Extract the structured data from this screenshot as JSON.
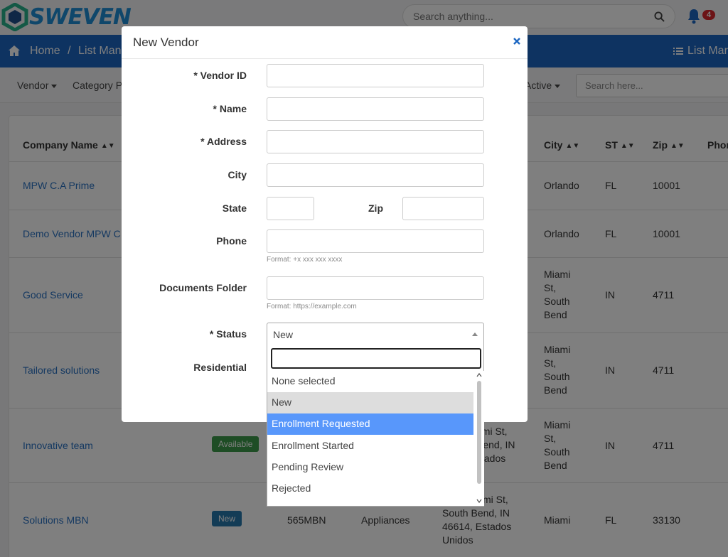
{
  "app": {
    "logo_text": "SWEVEN",
    "search_placeholder": "Search anything...",
    "notification_count": "4",
    "colors": {
      "brand_blue": "#1d67c2",
      "link": "#2b72c3",
      "badge_available": "#3d9a4a",
      "badge_new": "#2779ad",
      "select_active": "#5897fb"
    }
  },
  "navbar": {
    "home": "Home",
    "separator": "/",
    "list_manager": "List Mana",
    "right_label": "List Mar"
  },
  "filters": {
    "vendor": "Vendor",
    "category": "Category Pr",
    "active": "Active",
    "search_placeholder": "Search here..."
  },
  "table": {
    "headers": {
      "company": "Company Name",
      "city": "City",
      "st": "ST",
      "zip": "Zip",
      "phone": "Phon"
    },
    "rows": [
      {
        "company": "MPW C.A Prime",
        "city": "Orlando",
        "st": "FL",
        "zip": "10001"
      },
      {
        "company": "Demo Vendor MPW C.A",
        "city": "Orlando",
        "st": "FL",
        "zip": "10001"
      },
      {
        "company": "Good Service",
        "city": [
          "Miami",
          "St,",
          "South",
          "Bend"
        ],
        "st": "IN",
        "zip": "4711"
      },
      {
        "company": "Tailored solutions",
        "city": [
          "Miami",
          "St,",
          "South",
          "Bend"
        ],
        "st": "IN",
        "zip": "4711"
      },
      {
        "company": "Innovative team",
        "status": "Available",
        "address": [
          "ami St,",
          "Bend, IN",
          "stados"
        ],
        "city": [
          "Miami",
          "St,",
          "South",
          "Bend"
        ],
        "st": "IN",
        "zip": "4711"
      },
      {
        "company": "Solutions MBN",
        "status": "New",
        "vendor_id": "565MBN",
        "category": "Appliances",
        "address": [
          "mi St,",
          "South Bend, IN",
          "46614, Estados",
          "Unidos"
        ],
        "city": "Miami",
        "st": "FL",
        "zip": "33130"
      }
    ]
  },
  "modal": {
    "title": "New Vendor",
    "fields": {
      "vendor_id": "* Vendor ID",
      "name": "* Name",
      "address": "* Address",
      "city": "City",
      "state": "State",
      "zip": "Zip",
      "phone": "Phone",
      "phone_hint": "Format: +x xxx xxx xxxx",
      "documents_folder": "Documents Folder",
      "documents_hint": "Format: https://example.com",
      "status": "* Status",
      "residential": "Residential"
    },
    "status_selected": "New",
    "status_options": [
      "None selected",
      "New",
      "Enrollment Requested",
      "Enrollment Started",
      "Pending Review",
      "Rejected"
    ]
  }
}
